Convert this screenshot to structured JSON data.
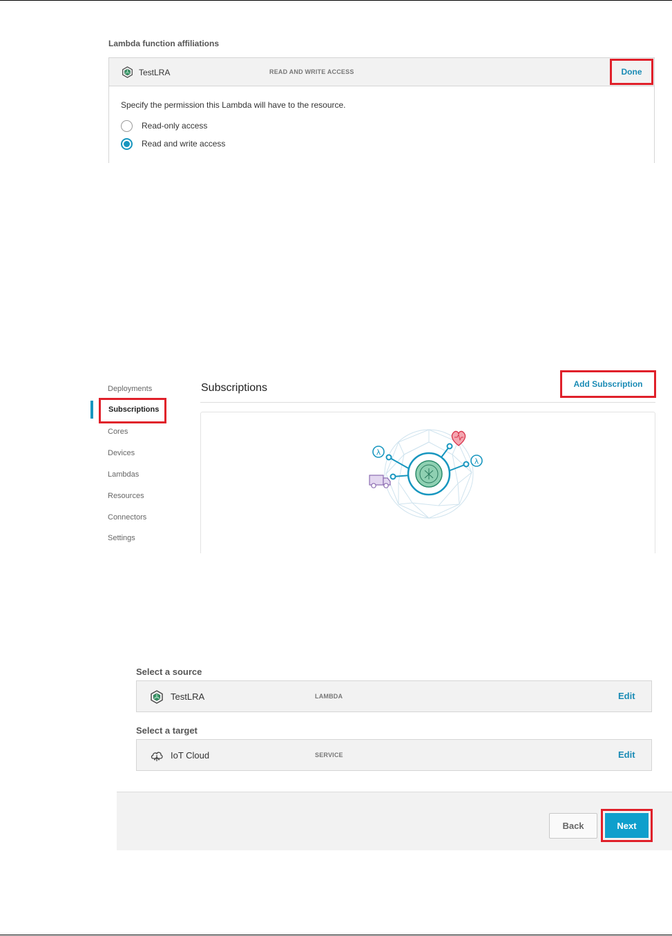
{
  "affiliations": {
    "heading": "Lambda function affiliations",
    "function_name": "TestLRA",
    "access_badge": "READ AND WRITE ACCESS",
    "done_label": "Done",
    "description": "Specify the permission this Lambda will have to the resource.",
    "options": [
      {
        "label": "Read-only access",
        "selected": false
      },
      {
        "label": "Read and write access",
        "selected": true
      }
    ]
  },
  "group_nav": {
    "items": [
      "Deployments",
      "Subscriptions",
      "Cores",
      "Devices",
      "Lambdas",
      "Resources",
      "Connectors",
      "Settings"
    ],
    "active": "Subscriptions"
  },
  "subscriptions": {
    "title": "Subscriptions",
    "add_label": "Add Subscription"
  },
  "subscription_wizard": {
    "source_label": "Select a source",
    "source": {
      "name": "TestLRA",
      "type": "LAMBDA",
      "edit": "Edit"
    },
    "target_label": "Select a target",
    "target": {
      "name": "IoT Cloud",
      "type": "SERVICE",
      "edit": "Edit"
    },
    "back_label": "Back",
    "next_label": "Next"
  },
  "colors": {
    "accent": "#1796bf",
    "highlight_frame": "#e0202a",
    "primary_button": "#0f9fcc"
  }
}
